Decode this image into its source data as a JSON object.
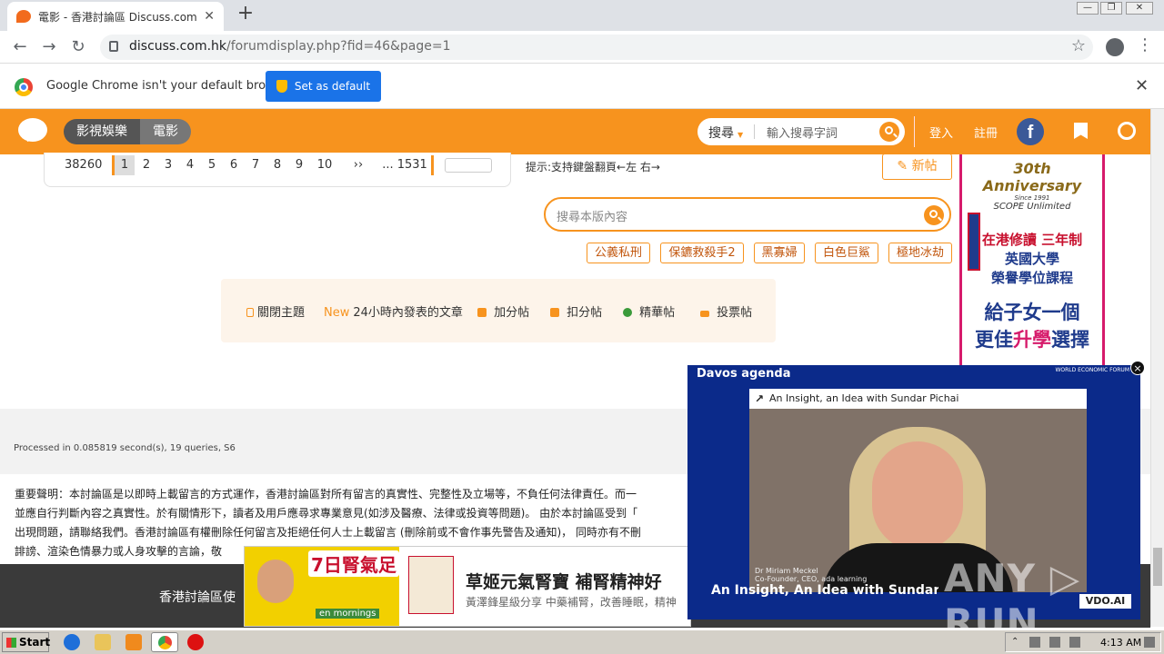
{
  "browser": {
    "tab_title": "電影 - 香港討論區 Discuss.com.hk - ",
    "url_host": "discuss.com.hk",
    "url_path": "/forumdisplay.php?fid=46&page=1",
    "infobar_message": "Google Chrome isn't your default browser",
    "set_default_label": "Set as default",
    "win_min": "—",
    "win_max": "❐",
    "win_close": "✕",
    "back": "←",
    "forward": "→",
    "reload": "↻",
    "new_tab": "+",
    "menu": "⋮",
    "tab_close": "✕",
    "bookmark_star": "☆",
    "info_close": "✕"
  },
  "site_header": {
    "breadcrumb": [
      "影視娛樂",
      "電影"
    ],
    "search_select": "搜尋",
    "search_placeholder": "輸入搜尋字詞",
    "login": "登入",
    "register": "註冊",
    "facebook": "f"
  },
  "pager": {
    "total": "38260",
    "pages": [
      "1",
      "2",
      "3",
      "4",
      "5",
      "6",
      "7",
      "8",
      "9",
      "10",
      "››",
      "... 1531"
    ],
    "current_page": "1"
  },
  "tip": "提示:支持鍵盤翻頁←左 右→",
  "new_post": "✎ 新帖",
  "forum_search_placeholder": "搜尋本版內容",
  "tags": [
    "公義私刑",
    "保鑣救殺手2",
    "黑寡婦",
    "白色巨鯊",
    "極地冰劫"
  ],
  "filters": {
    "closed": "關閉主題",
    "new_badge": "New",
    "new24": "24小時內發表的文章",
    "plus": "加分帖",
    "minus": "扣分帖",
    "digest": "精華帖",
    "poll": "投票帖"
  },
  "ad_right": {
    "anniv": "30th Anniversary",
    "since": "Since 1991",
    "scope": "SCOPE Unlimited",
    "line1": "在港修讀 三年制",
    "line2": "英國大學",
    "line3": "榮譽學位課程",
    "line4": "給子女一個",
    "line5a": "更佳",
    "line5b": "升學",
    "line5c": "選擇"
  },
  "footer": {
    "processed": "Processed in 0.085819 second(s), 19 queries, S6",
    "disclaimer_lines": [
      "重要聲明：本討論區是以即時上載留言的方式運作，香港討論區對所有留言的真實性、完整性及立場等，不負任何法律責任。而一",
      "並應自行判斷內容之真實性。於有關情形下，讀者及用戶應尋求專業意見(如涉及醫療、法律或投資等問題)。 由於本討論區受到「",
      "出現問題，請聯絡我們。香港討論區有權刪除任何留言及拒絕任何人士上載留言 (刪除前或不會作事先警告及通知)， 同時亦有不刪",
      "誹謗、渲染色情暴力或人身攻擊的言論，敬"
    ],
    "dark_text": "香港討論區使"
  },
  "ad_bottom": {
    "badge": "7日腎氣足",
    "headline": "草姬元氣腎寶 補腎精神好",
    "sub": "黃澤鋒星級分享 中藥補腎，改善睡眠，精神",
    "tag": "en mornings"
  },
  "video": {
    "davos": "Davos agenda",
    "wef": "WORLD ECONOMIC FORUM",
    "caption": "An Insight, an Idea with Sundar Pichai",
    "speaker": "Dr Miriam Meckel",
    "speaker_role": "Co-Founder, CEO, ada learning",
    "lower_caption": "An Insight, An Idea with Sundar P",
    "watermark": "ANY ▷ RUN",
    "vdo": "VDO.AI",
    "close": "×"
  },
  "taskbar": {
    "start": "Start",
    "time": "4:13 AM"
  }
}
